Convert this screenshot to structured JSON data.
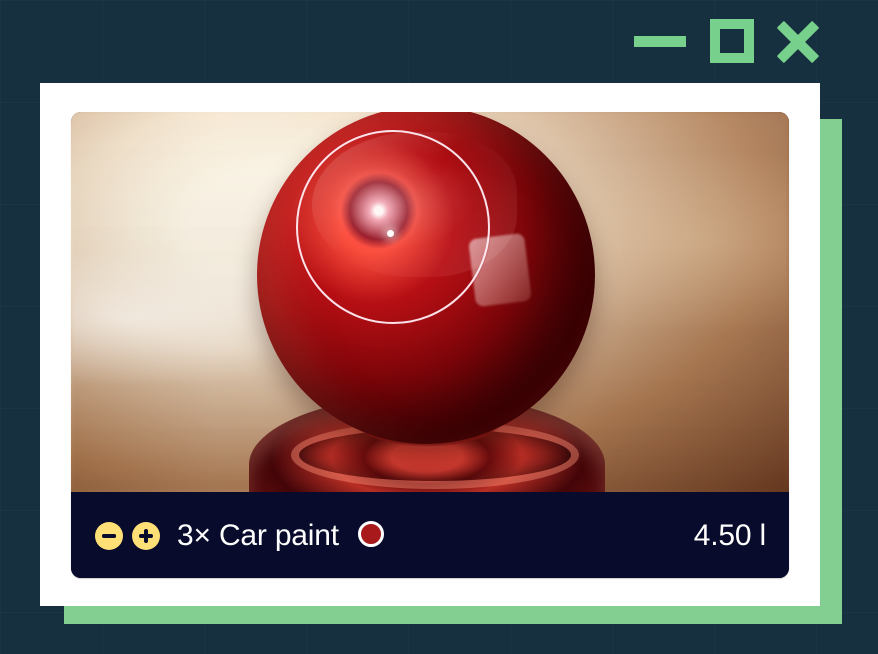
{
  "window": {
    "controls": [
      {
        "label": "",
        "icon": "minimize-icon"
      },
      {
        "label": "",
        "icon": "maximize-icon"
      },
      {
        "label": "",
        "icon": "close-icon"
      }
    ],
    "accent_color": "#77d18c",
    "background_color": "#17303f"
  },
  "product": {
    "quantity_controls": [
      {
        "icon": "minus-icon"
      },
      {
        "icon": "plus-icon"
      }
    ],
    "title": "3× Car paint",
    "color_swatch": "#a8191c",
    "volume": "4.50 l",
    "preview_icon": "car-paint-material-preview",
    "bar_color": "#080b2b",
    "button_color": "#ffe077"
  }
}
